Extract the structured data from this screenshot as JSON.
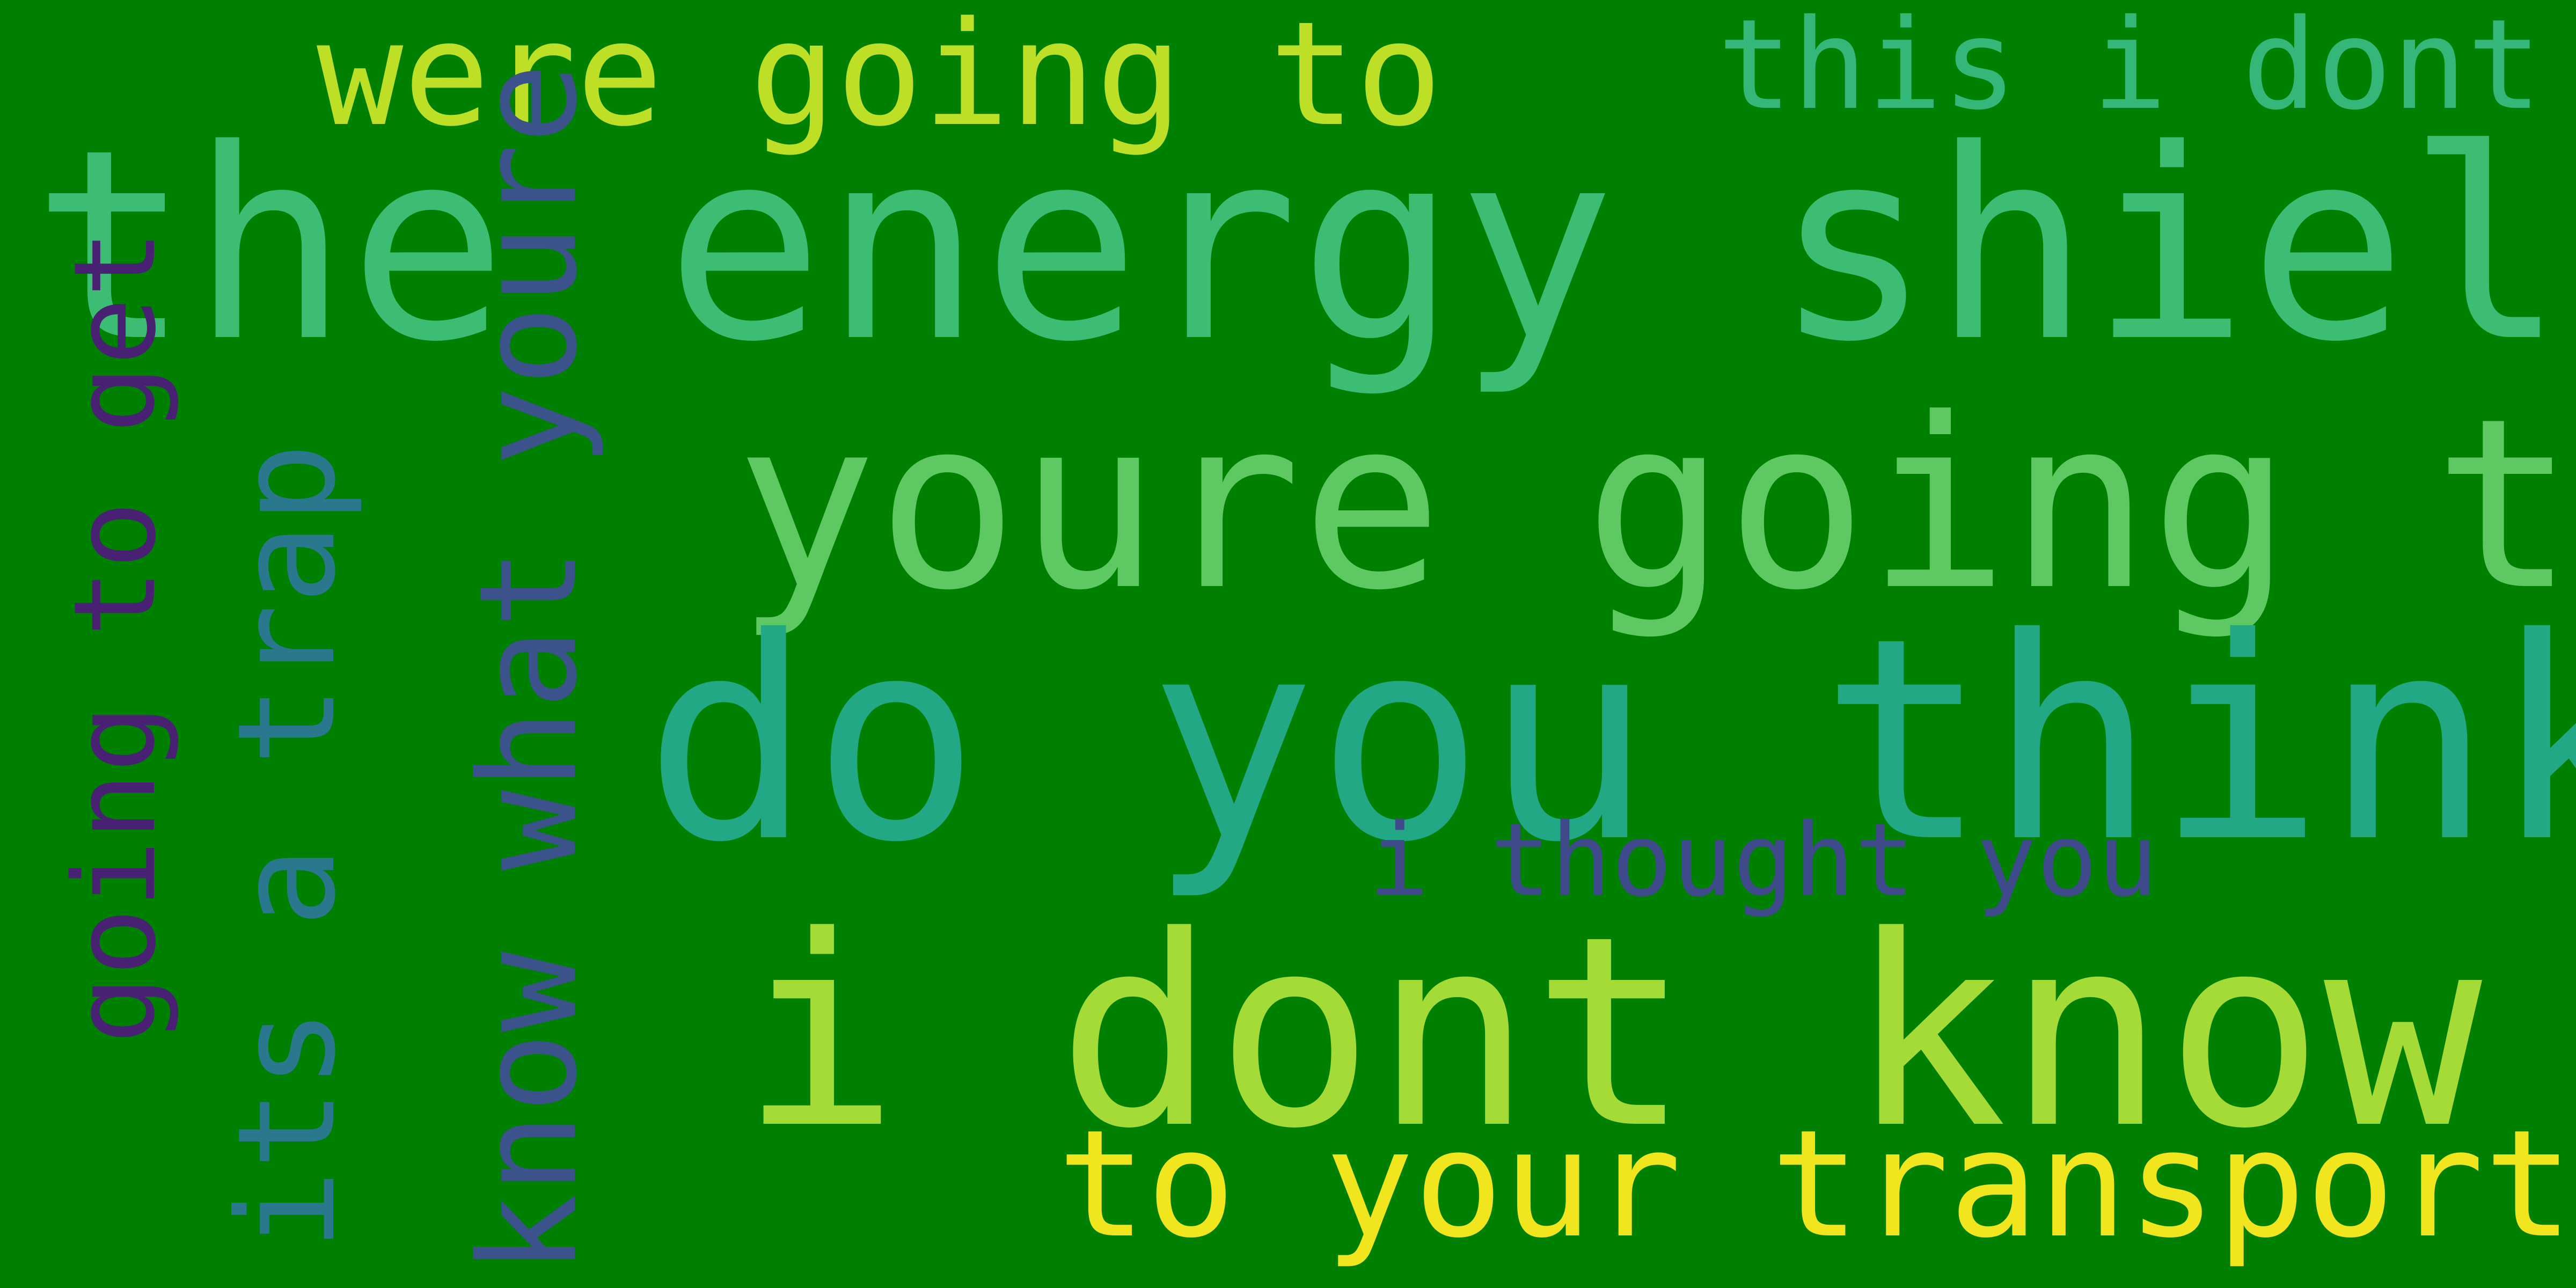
{
  "background_color": "#008000",
  "phrases": [
    {
      "text": "the energy shield",
      "color": "#3dbc74",
      "orientation": "horizontal"
    },
    {
      "text": "do you think",
      "color": "#22a884",
      "orientation": "horizontal"
    },
    {
      "text": "i dont know",
      "color": "#a5db36",
      "orientation": "horizontal"
    },
    {
      "text": "youre going to",
      "color": "#5ec962",
      "orientation": "horizontal"
    },
    {
      "text": "were going to",
      "color": "#bddf26",
      "orientation": "horizontal"
    },
    {
      "text": "know what youre",
      "color": "#3b528b",
      "orientation": "vertical"
    },
    {
      "text": "to your transports",
      "color": "#f1e51d",
      "orientation": "horizontal"
    },
    {
      "text": "its a trap",
      "color": "#2a788e",
      "orientation": "vertical"
    },
    {
      "text": "this i dont",
      "color": "#35b779",
      "orientation": "horizontal"
    },
    {
      "text": "going to get",
      "color": "#482173",
      "orientation": "vertical"
    },
    {
      "text": "i thought you",
      "color": "#3e4a89",
      "orientation": "horizontal"
    }
  ]
}
